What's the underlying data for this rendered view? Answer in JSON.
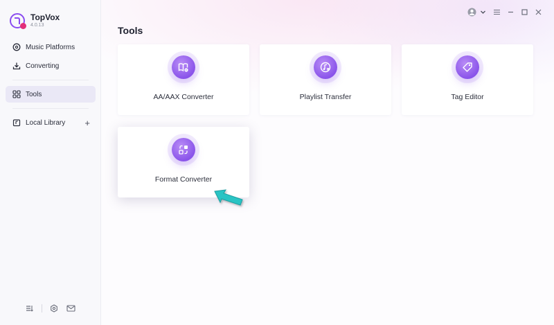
{
  "app": {
    "name": "TopVox",
    "version": "4.0.13"
  },
  "sidebar": {
    "items": [
      {
        "label": "Music Platforms",
        "icon": "music-disc-icon"
      },
      {
        "label": "Converting",
        "icon": "download-icon"
      },
      {
        "label": "Tools",
        "icon": "grid-icon",
        "active": true
      },
      {
        "label": "Local Library",
        "icon": "library-icon"
      }
    ],
    "add_label": "+"
  },
  "page": {
    "title": "Tools"
  },
  "tools": [
    {
      "label": "AA/AAX Converter",
      "icon": "audiobook-icon"
    },
    {
      "label": "Playlist Transfer",
      "icon": "playlist-icon"
    },
    {
      "label": "Tag Editor",
      "icon": "tag-icon"
    },
    {
      "label": "Format Converter",
      "icon": "format-convert-icon"
    }
  ],
  "colors": {
    "accent": "#8a54ea",
    "pointer": "#2bc4c4"
  }
}
